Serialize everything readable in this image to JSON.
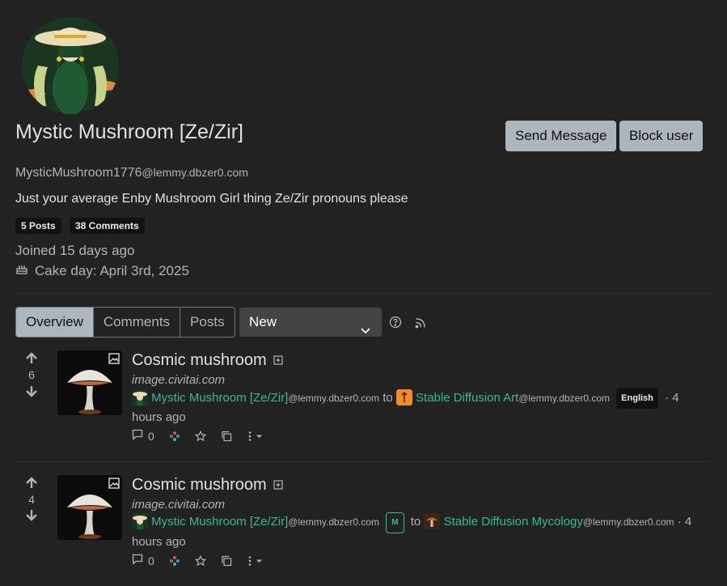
{
  "profile": {
    "display_name": "Mystic Mushroom [Ze/Zir]",
    "username": "MysticMushroom1776",
    "instance": "@lemmy.dbzer0.com",
    "bio": "Just your average Enby Mushroom Girl thing Ze/Zir pronouns please",
    "posts_badge": "5 Posts",
    "comments_badge": "38 Comments",
    "joined": "Joined 15 days ago",
    "cake_day": "Cake day: April 3rd, 2025",
    "send_message_label": "Send Message",
    "block_user_label": "Block user"
  },
  "tabs": [
    {
      "label": "Overview",
      "active": true
    },
    {
      "label": "Comments",
      "active": false
    },
    {
      "label": "Posts",
      "active": false
    }
  ],
  "sort": {
    "selected": "New"
  },
  "posts": [
    {
      "score": "6",
      "title": "Cosmic mushroom",
      "domain": "image.civitai.com",
      "author": "Mystic Mushroom [Ze/Zir]",
      "author_instance": "@lemmy.dbzer0.com",
      "to": "to",
      "community": "Stable Diffusion Art",
      "community_instance": "@lemmy.dbzer0.com",
      "language": "English",
      "time": "· 4 hours ago",
      "comments": "0"
    },
    {
      "score": "4",
      "title": "Cosmic mushroom",
      "domain": "image.civitai.com",
      "author": "Mystic Mushroom [Ze/Zir]",
      "author_instance": "@lemmy.dbzer0.com",
      "mod_badge": "M",
      "to": "to",
      "community": "Stable Diffusion Mycology",
      "community_instance": "@lemmy.dbzer0.com",
      "time": "· 4 hours ago",
      "comments": "0"
    }
  ],
  "colors": {
    "background": "#222222",
    "accent_link": "#3ab89a",
    "button_light": "#adb5bd"
  }
}
